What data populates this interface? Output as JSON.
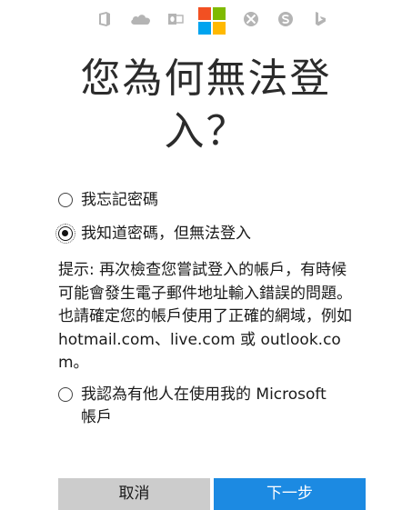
{
  "header": {
    "app_icons": [
      {
        "name": "office-icon",
        "glyph": "office"
      },
      {
        "name": "onedrive-icon",
        "glyph": "cloud"
      },
      {
        "name": "outlook-icon",
        "glyph": "outlook"
      },
      {
        "name": "microsoft-logo-icon",
        "glyph": "microsoft"
      },
      {
        "name": "xbox-icon",
        "glyph": "xbox"
      },
      {
        "name": "skype-icon",
        "glyph": "skype"
      },
      {
        "name": "bing-icon",
        "glyph": "bing"
      }
    ],
    "logo_colors": {
      "red": "#f25022",
      "green": "#7fba00",
      "blue": "#00a4ef",
      "yellow": "#ffb900"
    },
    "icon_color": "#b4b4b4"
  },
  "title": {
    "line1": "您為何無法登",
    "line2": "入？"
  },
  "options": [
    {
      "label": "我忘記密碼",
      "selected": false
    },
    {
      "label": "我知道密碼，但無法登入",
      "selected": true
    },
    {
      "label_line1": "我認為有他人在使用我的 Microsoft",
      "label_line2": "帳戶",
      "selected": false
    }
  ],
  "hint": {
    "text": "提示: 再次檢查您嘗試登入的帳戶，有時候可能會發生電子郵件地址輸入錯誤的問題。也請確定您的帳戶使用了正確的網域，例如 hotmail.com、live.com 或 outlook.com。"
  },
  "buttons": {
    "cancel_label": "取消",
    "next_label": "下一步",
    "cancel_color": "#cccccc",
    "next_color": "#1c8ae2"
  }
}
